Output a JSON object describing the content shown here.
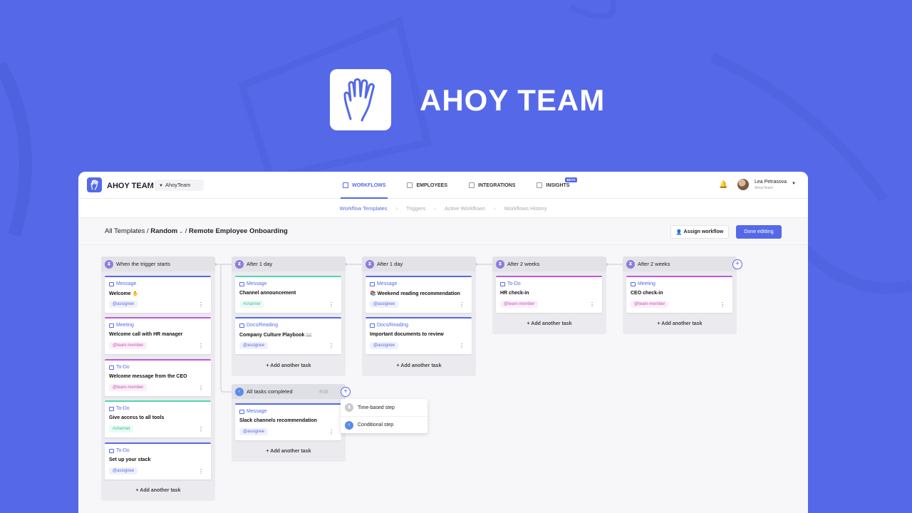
{
  "hero": {
    "title": "AHOY TEAM"
  },
  "topbar": {
    "app_name": "AHOY TEAM",
    "team_select": "AhoyTeam",
    "nav": [
      {
        "label": "WORKFLOWS",
        "icon": "workflow-icon"
      },
      {
        "label": "EMPLOYEES",
        "icon": "employees-icon"
      },
      {
        "label": "INTEGRATIONS",
        "icon": "integrations-icon"
      },
      {
        "label": "INSIGHTS",
        "icon": "insights-icon",
        "badge": "BETA"
      }
    ],
    "user": {
      "name": "Lea Petrasova",
      "org": "AhoyTeam"
    }
  },
  "subnav": [
    "Workflow Templates",
    "Triggers",
    "Active Workflows",
    "Workflows History"
  ],
  "header": {
    "crumb_root": "All Templates",
    "crumb_folder": "Random",
    "crumb_page": "Remote Employee Onboarding",
    "assign_label": "Assign workflow",
    "done_label": "Done editting"
  },
  "columns": [
    {
      "title": "When the trigger starts",
      "cards": [
        {
          "type": "Message",
          "title": "Welcome ✋",
          "tag": "@assignee"
        },
        {
          "type": "Meeting",
          "title": "Welcome call with HR manager",
          "tag": "@team-member"
        },
        {
          "type": "To-Do",
          "title": "Welcome message from the CEO",
          "tag": "@team-member"
        },
        {
          "type": "To-Do",
          "title": "Give access to all tools",
          "tag": "#channel"
        },
        {
          "type": "To-Do",
          "title": "Set up your stack",
          "tag": "@assignee"
        }
      ],
      "add": "+ Add another task"
    },
    {
      "title": "After 1 day",
      "cards": [
        {
          "type": "Message",
          "title": "Channel announcement",
          "tag": "#channel"
        },
        {
          "type": "Docs/Reading",
          "title": "Company Culture Playbook 📖",
          "tag": "@assignee"
        }
      ],
      "add": "+ Add another task"
    },
    {
      "title": "After 1 day",
      "cards": [
        {
          "type": "Message",
          "title": "📚 Weekend reading recommendation",
          "tag": "@assignee"
        },
        {
          "type": "Docs/Reading",
          "title": "Important documents to review",
          "tag": "@assignee"
        }
      ],
      "add": "+ Add another task"
    },
    {
      "title": "After 2 weeks",
      "cards": [
        {
          "type": "To-Do",
          "title": "HR check-in",
          "tag": "@team-member"
        }
      ],
      "add": "+ Add another task"
    },
    {
      "title": "After 2 weeks",
      "cards": [
        {
          "type": "Meeting",
          "title": "CEO check-in",
          "tag": "@team-member"
        }
      ],
      "add": "+ Add another task"
    },
    {
      "title": "All tasks completed",
      "edit": "Edit",
      "cards": [
        {
          "type": "Message",
          "title": "Slack channels recommendation",
          "tag": "@assignee"
        }
      ],
      "add": "+ Add another task"
    }
  ],
  "step_menu": [
    "Time-based step",
    "Conditional step"
  ],
  "colors": {
    "brand": "#5569e8",
    "pink": "#c058d8",
    "green": "#4fd6b0",
    "background": "#5569e8"
  }
}
